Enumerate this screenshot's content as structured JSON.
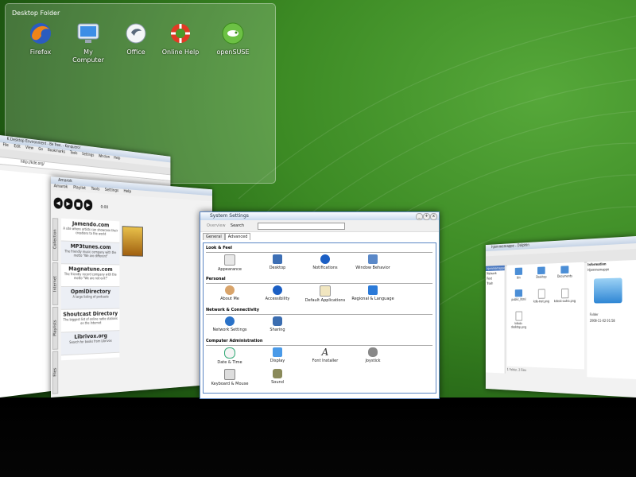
{
  "desktop_folder": {
    "title": "Desktop Folder",
    "icons": [
      {
        "label": "Firefox",
        "icon": "firefox-icon"
      },
      {
        "label": "My",
        "label2": "Computer",
        "icon": "computer-icon"
      },
      {
        "label": "Office",
        "icon": "office-icon"
      },
      {
        "label": "Online Help",
        "icon": "lifebuoy-icon"
      },
      {
        "label": "openSUSE",
        "icon": "opensuse-icon"
      }
    ]
  },
  "konqueror": {
    "title": "K Desktop Environment - Be free. - Konqueror",
    "menu": [
      "File",
      "Edit",
      "View",
      "Go",
      "Bookmarks",
      "Tools",
      "Settings",
      "Window",
      "Help"
    ],
    "address": "http://kde.org/"
  },
  "amarok": {
    "title": "Amarok",
    "menu": [
      "Amarok",
      "Playlist",
      "Tools",
      "Settings",
      "Help"
    ],
    "time": "0:00",
    "side_tabs": [
      "Collection",
      "Internet",
      "Playlists",
      "Files"
    ],
    "services": [
      {
        "name": "Jamendo.com",
        "desc": "A site where artists can showcase their creations to the world"
      },
      {
        "name": "MP3tunes.com",
        "desc": "The friendly music company with the motto \"We are different\""
      },
      {
        "name": "Magnatune.com",
        "desc": "The friendly record company with the motto \"We are not evil!\""
      },
      {
        "name": "OpmlDirectory",
        "desc": "A large listing of podcasts"
      },
      {
        "name": "Shoutcast Directory",
        "desc": "The biggest list of online radio stations on the Internet"
      },
      {
        "name": "Librivox.org",
        "desc": "Search for books from Librivox"
      }
    ]
  },
  "system_settings": {
    "title": "System Settings",
    "toolbar": {
      "overview": "Overview",
      "search": "Search"
    },
    "tabs": [
      "General",
      "Advanced"
    ],
    "sections": [
      {
        "title": "Look & Feel",
        "modules": [
          "Appearance",
          "Desktop",
          "Notifications",
          "Window Behavior"
        ]
      },
      {
        "title": "Personal",
        "modules": [
          "About Me",
          "Accessibility",
          "Default Applications",
          "Regional & Language"
        ]
      },
      {
        "title": "Network & Connectivity",
        "modules": [
          "Network Settings",
          "Sharing"
        ]
      },
      {
        "title": "Computer Administration",
        "modules": [
          "Date & Time",
          "Display",
          "Font Installer",
          "Joystick",
          "Keyboard & Mouse",
          "Sound"
        ]
      }
    ]
  },
  "dolphin": {
    "title": "hjemmemappe - Dolphin",
    "places": [
      "hjemmemappe",
      "Network",
      "Root",
      "Trash"
    ],
    "files": [
      "bin",
      "Desktop",
      "Documents",
      "public_html",
      "kde-inst.png",
      "kdesk-outro.png",
      "kdesk-desktop.png"
    ],
    "info": {
      "title": "Information",
      "name": "Hjemmemappe",
      "type": "Folder",
      "modified": "2008-11-02 01:58"
    },
    "status": "1 Folder, 2 Files"
  }
}
